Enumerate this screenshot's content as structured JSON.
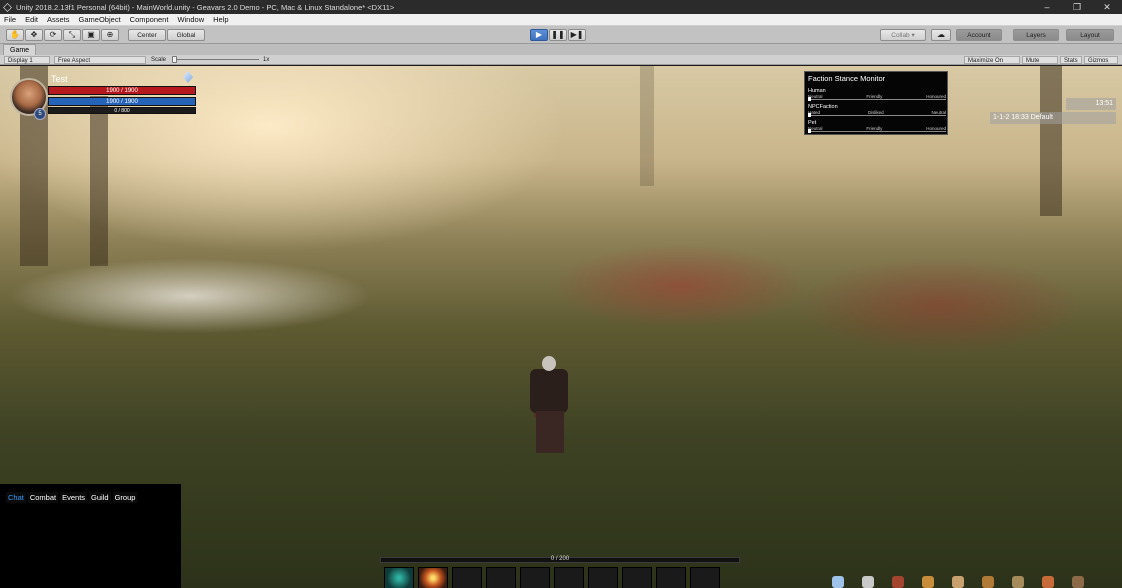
{
  "window": {
    "title": "Unity 2018.2.13f1 Personal (64bit) - MainWorld.unity - Geavars 2.0 Demo - PC, Mac & Linux Standalone* <DX11>",
    "controls": [
      "–",
      "❐",
      "✕"
    ]
  },
  "menu": [
    "File",
    "Edit",
    "Assets",
    "GameObject",
    "Component",
    "Window",
    "Help"
  ],
  "toolbar": {
    "pivot": "Center",
    "space": "Global",
    "collab": "Collab ▾",
    "account": "Account",
    "layers": "Layers",
    "layout": "Layout"
  },
  "game_view": {
    "tab": "Game",
    "display": "Display 1",
    "aspect": "Free Aspect",
    "scale_label": "Scale",
    "scale_value": "1x",
    "options": [
      "Maximize On Play",
      "Mute Audio",
      "Stats",
      "Gizmos"
    ]
  },
  "player": {
    "name": "Test",
    "level": "5",
    "health": "1900 / 1900",
    "mana": "1900 / 1900",
    "exp": "0 / 800"
  },
  "faction_monitor": {
    "title": "Faction Stance Monitor",
    "rows": [
      {
        "name": "Human",
        "labels": [
          "Neutral",
          "Friendly",
          "Honoured"
        ]
      },
      {
        "name": "NPCFaction",
        "labels": [
          "Hated",
          "Disliked",
          "Neutral"
        ]
      },
      {
        "name": "Pet",
        "labels": [
          "Neutral",
          "Friendly",
          "Honoured"
        ]
      }
    ]
  },
  "clock": "13:51",
  "server": "1-1-2 18:33 Default",
  "chat_tabs": [
    "Chat",
    "Combat",
    "Events",
    "Guild",
    "Group"
  ],
  "xp_bar": "0 / 200",
  "colors": {
    "chat_active": "#2e9bff",
    "health": "#b5191e",
    "mana": "#2563b8",
    "play": "#3e71bd"
  }
}
